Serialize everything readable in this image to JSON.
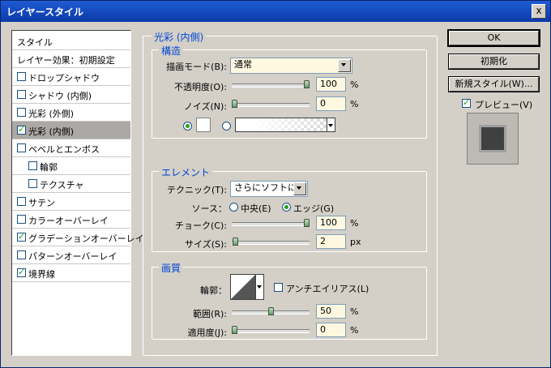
{
  "window": {
    "title": "レイヤースタイル",
    "close": "x"
  },
  "style_list": [
    {
      "label": "スタイル",
      "kind": "plain",
      "checked": false,
      "selected": false
    },
    {
      "label": "レイヤー効果：初期設定",
      "kind": "plain",
      "checked": false,
      "selected": false
    },
    {
      "label": "ドロップシャドウ",
      "kind": "check",
      "checked": false,
      "selected": false
    },
    {
      "label": "シャドウ (内側)",
      "kind": "check",
      "checked": false,
      "selected": false
    },
    {
      "label": "光彩 (外側)",
      "kind": "check",
      "checked": false,
      "selected": false
    },
    {
      "label": "光彩 (内側)",
      "kind": "check",
      "checked": true,
      "selected": true
    },
    {
      "label": "ベベルとエンボス",
      "kind": "check",
      "checked": false,
      "selected": false
    },
    {
      "label": "輪郭",
      "kind": "indent",
      "checked": false,
      "selected": false
    },
    {
      "label": "テクスチャ",
      "kind": "indent",
      "checked": false,
      "selected": false
    },
    {
      "label": "サテン",
      "kind": "check",
      "checked": false,
      "selected": false
    },
    {
      "label": "カラーオーバーレイ",
      "kind": "check",
      "checked": false,
      "selected": false
    },
    {
      "label": "グラデーションオーバーレイ",
      "kind": "check",
      "checked": true,
      "selected": false
    },
    {
      "label": "パターンオーバーレイ",
      "kind": "check",
      "checked": false,
      "selected": false
    },
    {
      "label": "境界線",
      "kind": "check",
      "checked": true,
      "selected": false
    }
  ],
  "panel": {
    "title": "光彩 (内側)",
    "structure": {
      "legend": "構造",
      "blend_mode_label": "描画モード(B):",
      "blend_mode_value": "通常",
      "opacity_label": "不透明度(O):",
      "opacity_value": "100",
      "opacity_fraction": 1.0,
      "noise_label": "ノイズ(N):",
      "noise_value": "0",
      "noise_fraction": 0.0,
      "unit_percent": "%"
    },
    "elements": {
      "legend": "エレメント",
      "technique_label": "テクニック(T):",
      "technique_value": "さらにソフトに",
      "source_label": "ソース：",
      "source_center": "中央(E)",
      "source_edge": "エッジ(G)",
      "choke_label": "チョーク(C):",
      "choke_value": "100",
      "choke_fraction": 1.0,
      "size_label": "サイズ(S):",
      "size_value": "2",
      "size_fraction": 0.01,
      "unit_percent": "%",
      "unit_px": "px"
    },
    "quality": {
      "legend": "画質",
      "contour_label": "輪郭：",
      "antialias_label": "アンチエイリアス(L)",
      "range_label": "範囲(R):",
      "range_value": "50",
      "range_fraction": 0.5,
      "jitter_label": "適用度(J):",
      "jitter_value": "0",
      "jitter_fraction": 0.0,
      "unit_percent": "%"
    }
  },
  "buttons": {
    "ok": "OK",
    "reset": "初期化",
    "new_style": "新規スタイル(W)...",
    "preview_label": "プレビュー(V)"
  },
  "colors": {
    "glow_color": "#ffffff",
    "accent": "#0046d5",
    "check": "#21a121"
  }
}
